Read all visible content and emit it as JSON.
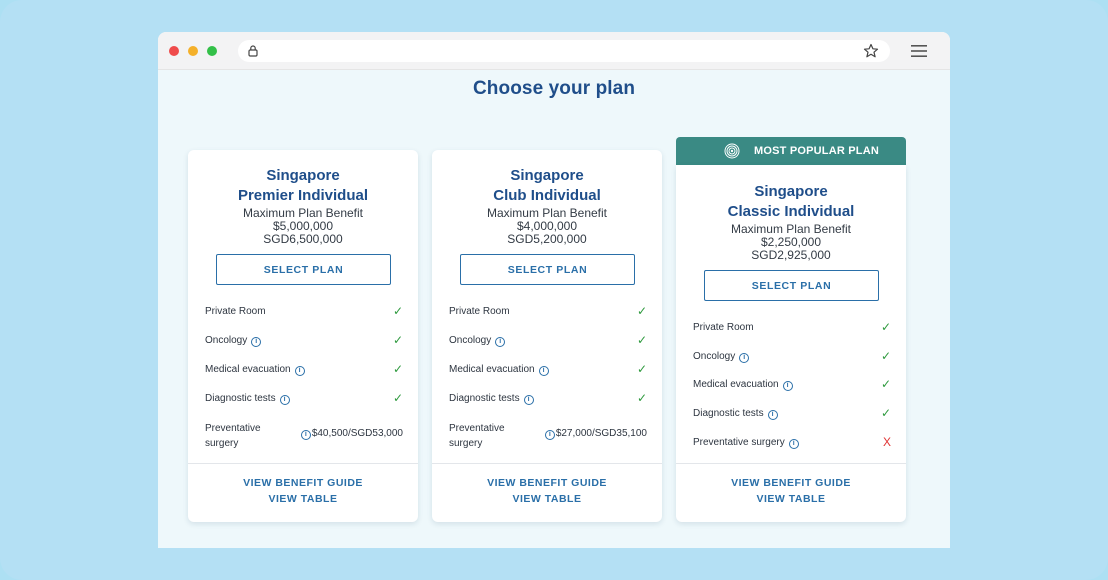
{
  "page": {
    "title": "Choose your plan"
  },
  "icons": {
    "lock": "lock-icon",
    "bookmark": "star-icon",
    "menu": "hamburger-menu-icon",
    "badge": "spiral-icon",
    "info": "info-icon"
  },
  "colors": {
    "primary": "#1f4e8a",
    "accent": "#2a6fa8",
    "badge": "#3a8a84",
    "check": "#2e9a3e",
    "cross": "#e03434"
  },
  "badge": {
    "label": "MOST POPULAR PLAN"
  },
  "plans": [
    {
      "name_line1": "Singapore",
      "name_line2": "Premier Individual",
      "benefit_label": "Maximum Plan Benefit",
      "usd": "$5,000,000",
      "sgd": "SGD6,500,000",
      "button": "SELECT PLAN",
      "features": {
        "private_room": "Private Room",
        "oncology": "Oncology",
        "medical_evacuation": "Medical evacuation",
        "diagnostic_tests": "Diagnostic tests",
        "preventative_line1": "Preventative",
        "preventative_line2": "surgery",
        "preventative_value": "$40,500/SGD53,000",
        "check": "✓"
      },
      "links": {
        "guide": "VIEW BENEFIT GUIDE",
        "table": "VIEW TABLE"
      }
    },
    {
      "name_line1": "Singapore",
      "name_line2": "Club Individual",
      "benefit_label": "Maximum Plan Benefit",
      "usd": "$4,000,000",
      "sgd": "SGD5,200,000",
      "button": "SELECT PLAN",
      "features": {
        "private_room": "Private Room",
        "oncology": "Oncology",
        "medical_evacuation": "Medical evacuation",
        "diagnostic_tests": "Diagnostic tests",
        "preventative_line1": "Preventative",
        "preventative_line2": "surgery",
        "preventative_value": "$27,000/SGD35,100",
        "check": "✓"
      },
      "links": {
        "guide": "VIEW BENEFIT GUIDE",
        "table": "VIEW TABLE"
      }
    },
    {
      "name_line1": "Singapore",
      "name_line2": "Classic Individual",
      "benefit_label": "Maximum Plan Benefit",
      "usd": "$2,250,000",
      "sgd": "SGD2,925,000",
      "button": "SELECT PLAN",
      "features": {
        "private_room": "Private Room",
        "oncology": "Oncology",
        "medical_evacuation": "Medical evacuation",
        "diagnostic_tests": "Diagnostic tests",
        "preventative": "Preventative surgery",
        "check": "✓",
        "cross": "X"
      },
      "links": {
        "guide": "VIEW BENEFIT GUIDE",
        "table": "VIEW TABLE"
      }
    }
  ]
}
